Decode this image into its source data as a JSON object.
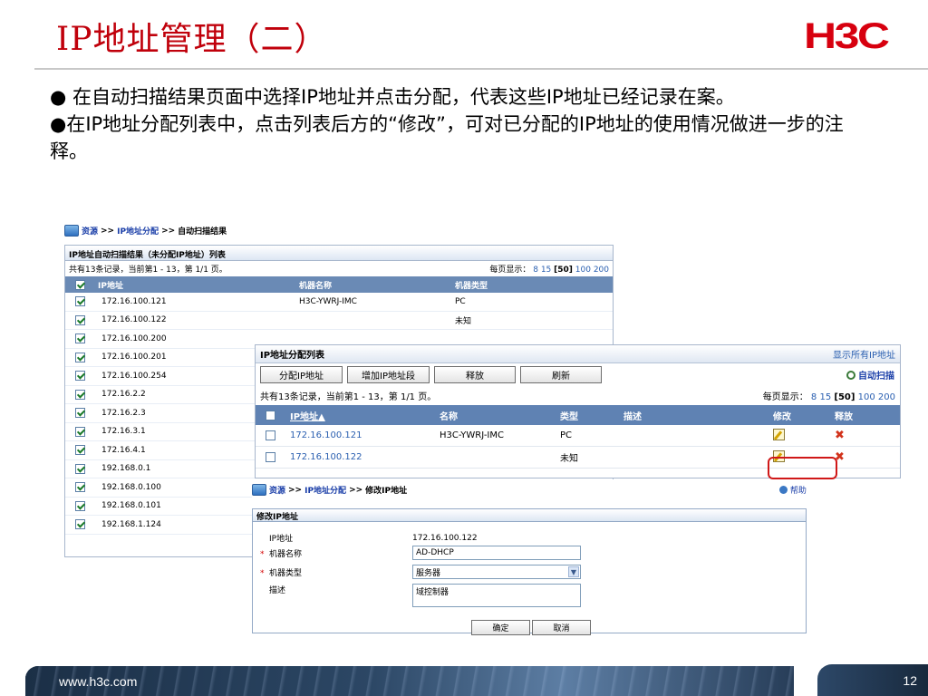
{
  "slide": {
    "title": "IP地址管理（二）",
    "logo": "H3C",
    "bullet1": "● 在自动扫描结果页面中选择IP地址并点击分配，代表这些IP地址已经记录在案。",
    "bullet2": "●在IP地址分配列表中，点击列表后方的“修改”，可对已分配的IP地址的使用情况做进一步的注释。",
    "footer_url": "www.h3c.com",
    "page_number": "12"
  },
  "scan": {
    "breadcrumb": [
      "资源",
      ">>",
      "IP地址分配",
      ">>",
      "自动扫描结果"
    ],
    "panel_title": "IP地址自动扫描结果（未分配IP地址）列表",
    "record_info": "共有13条记录，当前第1 - 13，第 1/1 页。",
    "page_size_label": "每页显示：",
    "page_size_8": "8",
    "page_size_15": "15",
    "page_size_50": "[50]",
    "page_size_200": "100 200",
    "columns": [
      "IP地址",
      "机器名称",
      "机器类型"
    ],
    "rows": [
      {
        "ip": "172.16.100.121",
        "name": "H3C-YWRJ-IMC",
        "type": "PC"
      },
      {
        "ip": "172.16.100.122",
        "name": "",
        "type": "未知"
      },
      {
        "ip": "172.16.100.200",
        "name": "",
        "type": ""
      },
      {
        "ip": "172.16.100.201",
        "name": "",
        "type": ""
      },
      {
        "ip": "172.16.100.254",
        "name": "",
        "type": ""
      },
      {
        "ip": "172.16.2.2",
        "name": "",
        "type": ""
      },
      {
        "ip": "172.16.2.3",
        "name": "",
        "type": ""
      },
      {
        "ip": "172.16.3.1",
        "name": "",
        "type": ""
      },
      {
        "ip": "172.16.4.1",
        "name": "",
        "type": ""
      },
      {
        "ip": "192.168.0.1",
        "name": "",
        "type": ""
      },
      {
        "ip": "192.168.0.100",
        "name": "",
        "type": ""
      },
      {
        "ip": "192.168.0.101",
        "name": "",
        "type": ""
      },
      {
        "ip": "192.168.1.124",
        "name": "",
        "type": ""
      }
    ]
  },
  "alloc": {
    "panel_title": "IP地址分配列表",
    "show_all": "显示所有IP地址",
    "buttons": [
      "分配IP地址",
      "增加IP地址段",
      "释放",
      "刷新"
    ],
    "auto_scan": "自动扫描",
    "record_info": "共有13条记录，当前第1 - 13，第 1/1 页。",
    "page_size_label": "每页显示：",
    "page_size_8": "8",
    "page_size_15": "15",
    "page_size_50": "[50]",
    "page_size_200": "100 200",
    "columns": [
      "IP地址▲",
      "名称",
      "类型",
      "描述",
      "修改",
      "释放"
    ],
    "rows": [
      {
        "ip": "172.16.100.121",
        "name": "H3C-YWRJ-IMC",
        "type": "PC",
        "desc": ""
      },
      {
        "ip": "172.16.100.122",
        "name": "",
        "type": "未知",
        "desc": ""
      }
    ]
  },
  "modify": {
    "breadcrumb": [
      "资源",
      ">>",
      "IP地址分配",
      ">>",
      "修改IP地址"
    ],
    "help": "帮助",
    "panel_title": "修改IP地址",
    "ip_label": "IP地址",
    "ip_value": "172.16.100.122",
    "name_label": "机器名称",
    "name_value": "AD-DHCP",
    "type_label": "机器类型",
    "type_value": "服务器",
    "desc_label": "描述",
    "desc_value": "域控制器",
    "ok": "确定",
    "cancel": "取消"
  }
}
